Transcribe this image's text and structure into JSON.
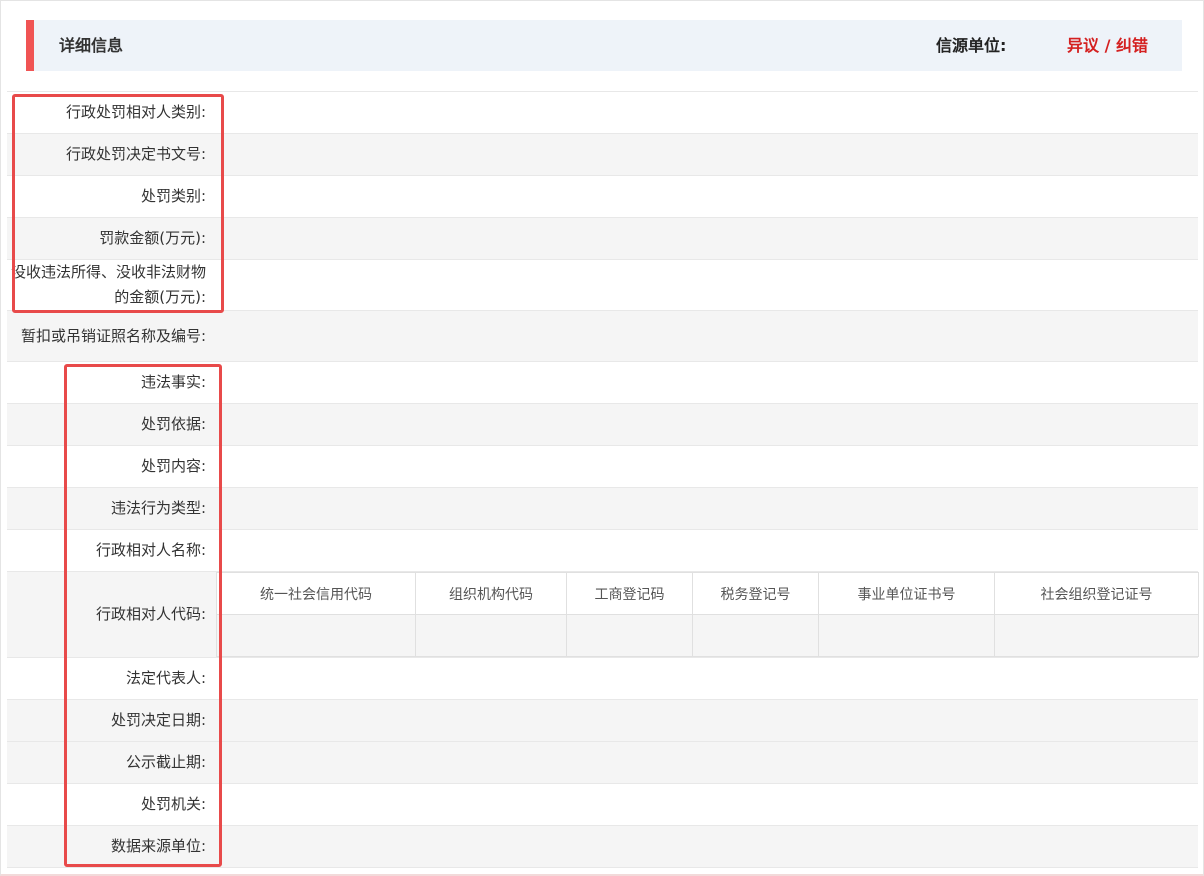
{
  "header": {
    "title": "详细信息",
    "source_label": "信源单位:",
    "dispute_link": "异议 / 纠错"
  },
  "rows": [
    {
      "label": "行政处罚相对人类别:",
      "value": ""
    },
    {
      "label": "行政处罚决定书文号:",
      "value": ""
    },
    {
      "label": "处罚类别:",
      "value": ""
    },
    {
      "label": "罚款金额(万元):",
      "value": ""
    },
    {
      "label": "没收违法所得、没收非法财物的金额(万元):",
      "value": ""
    },
    {
      "label": "暂扣或吊销证照名称及编号:",
      "value": ""
    },
    {
      "label": "违法事实:",
      "value": ""
    },
    {
      "label": "处罚依据:",
      "value": ""
    },
    {
      "label": "处罚内容:",
      "value": ""
    },
    {
      "label": "违法行为类型:",
      "value": ""
    },
    {
      "label": "行政相对人名称:",
      "value": ""
    },
    {
      "label": "行政相对人代码:",
      "value": ""
    },
    {
      "label": "法定代表人:",
      "value": ""
    },
    {
      "label": "处罚决定日期:",
      "value": ""
    },
    {
      "label": "公示截止期:",
      "value": ""
    },
    {
      "label": "处罚机关:",
      "value": ""
    },
    {
      "label": "数据来源单位:",
      "value": ""
    }
  ],
  "codes": {
    "headers": [
      "统一社会信用代码",
      "组织机构代码",
      "工商登记码",
      "税务登记号",
      "事业单位证书号",
      "社会组织登记证号"
    ],
    "values": [
      "",
      "",
      "",
      "",
      "",
      ""
    ]
  },
  "colors": {
    "accent": "#f05454",
    "dispute_link": "#d42020",
    "highlight_border": "#e84a4a",
    "header_background": "#eef3f9",
    "stripe": "#f5f5f5"
  }
}
